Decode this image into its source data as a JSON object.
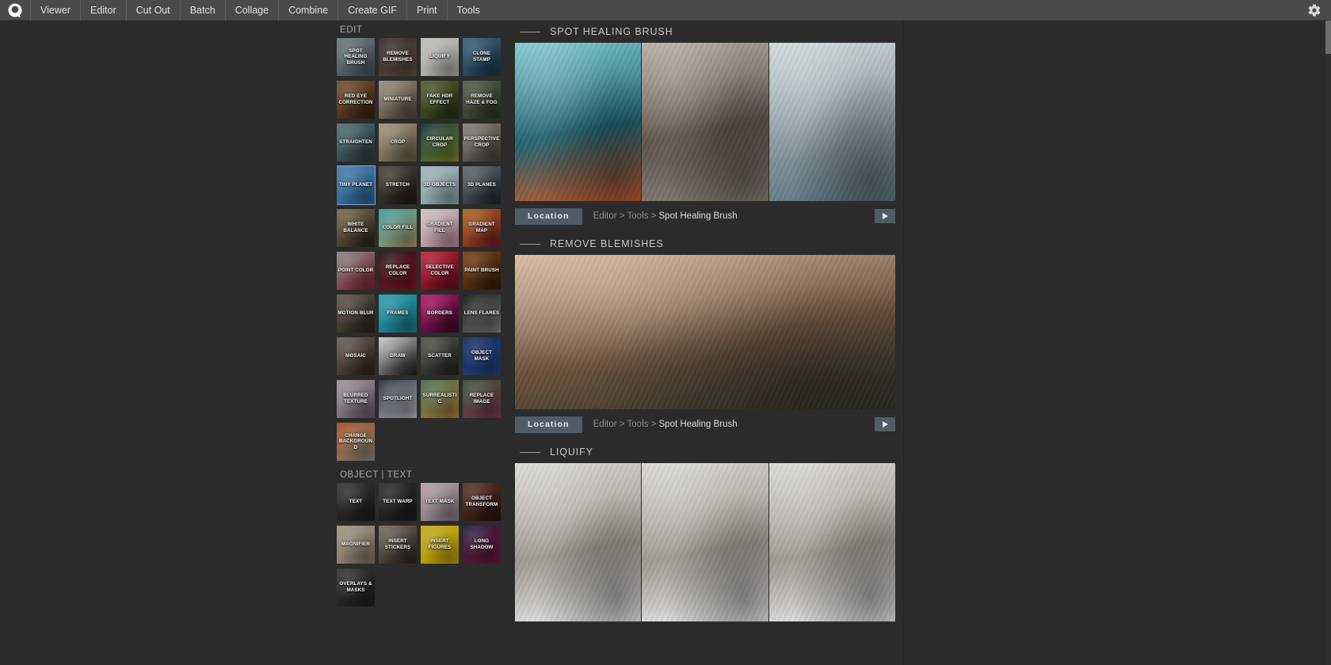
{
  "app": {
    "logo_icon": "app-logo-icon",
    "gear_icon": "gear-icon"
  },
  "menubar": {
    "items": [
      {
        "label": "Viewer"
      },
      {
        "label": "Editor"
      },
      {
        "label": "Cut Out"
      },
      {
        "label": "Batch"
      },
      {
        "label": "Collage"
      },
      {
        "label": "Combine"
      },
      {
        "label": "Create GIF"
      },
      {
        "label": "Print"
      },
      {
        "label": "Tools"
      }
    ]
  },
  "sections": [
    {
      "id": "edit",
      "title": "EDIT",
      "tiles": [
        {
          "label": "SPOT HEALING BRUSH",
          "c1": "#7d8a90",
          "c2": "#4a5a63",
          "sel": false
        },
        {
          "label": "REMOVE BLEMISHES",
          "c1": "#3a2f2c",
          "c2": "#6b5548",
          "sel": false
        },
        {
          "label": "LIQUIFY",
          "c1": "#d8d8d4",
          "c2": "#b9b9b4",
          "sel": false
        },
        {
          "label": "CLONE STAMP",
          "c1": "#3d6f92",
          "c2": "#203a4c",
          "sel": false
        },
        {
          "label": "RED EYE CORRECTION",
          "c1": "#8a5c36",
          "c2": "#3c2414",
          "sel": false
        },
        {
          "label": "MINIATURE",
          "c1": "#b2a48e",
          "c2": "#58493a",
          "sel": false
        },
        {
          "label": "FAKE HDR EFFECT",
          "c1": "#5f6b34",
          "c2": "#2b3317",
          "sel": false
        },
        {
          "label": "REMOVE HAZE & FOG",
          "c1": "#5f6a4d",
          "c2": "#30382a",
          "sel": false
        },
        {
          "label": "STRAIGHTEN",
          "c1": "#5b7e86",
          "c2": "#2b3e46",
          "sel": false
        },
        {
          "label": "CROP",
          "c1": "#b9a98c",
          "c2": "#6b5f48",
          "sel": false
        },
        {
          "label": "CIRCULAR CROP",
          "c1": "#10323f",
          "c2": "#8a9a32",
          "sel": false
        },
        {
          "label": "PERSPECTIVE CROP",
          "c1": "#9a9184",
          "c2": "#4a443c",
          "sel": false
        },
        {
          "label": "TINY PLANET",
          "c1": "#4f8fc4",
          "c2": "#2f6b9e",
          "sel": true
        },
        {
          "label": "STRETCH",
          "c1": "#5a5246",
          "c2": "#1e1a16",
          "sel": false
        },
        {
          "label": "3D OBJECTS",
          "c1": "#b9cfd2",
          "c2": "#8fb0b5",
          "sel": false
        },
        {
          "label": "3D PLANES",
          "c1": "#6e7a84",
          "c2": "#23282e",
          "sel": false
        },
        {
          "label": "WHITE BALANCE",
          "c1": "#8d7a58",
          "c2": "#2e2419",
          "sel": false
        },
        {
          "label": "COLOR FILL",
          "c1": "#3fb3b0",
          "c2": "#c2a36b",
          "sel": false
        },
        {
          "label": "GRADIENT FILL",
          "c1": "#e8e2dc",
          "c2": "#c98fa3",
          "sel": false
        },
        {
          "label": "GRADIENT MAP",
          "c1": "#c8741a",
          "c2": "#7a1a2a",
          "sel": false
        },
        {
          "label": "POINT COLOR",
          "c1": "#9b9a96",
          "c2": "#8b2030",
          "sel": false
        },
        {
          "label": "REPLACE COLOR",
          "c1": "#2a1416",
          "c2": "#8d1c28",
          "sel": false
        },
        {
          "label": "SELECTIVE COLOR",
          "c1": "#d6263f",
          "c2": "#6e0f1c",
          "sel": false
        },
        {
          "label": "PAINT BRUSH",
          "c1": "#8a4a1c",
          "c2": "#3a1c0a",
          "sel": false
        },
        {
          "label": "MOTION BLUR",
          "c1": "#6e6257",
          "c2": "#2a241e",
          "sel": false
        },
        {
          "label": "FRAMES",
          "c1": "#2db3c8",
          "c2": "#1b7e93",
          "sel": false
        },
        {
          "label": "BORDERS",
          "c1": "#d0197a",
          "c2": "#3a0a2a",
          "sel": false
        },
        {
          "label": "LENS FLARES",
          "c1": "#141414",
          "c2": "#8e8e8e",
          "sel": false
        },
        {
          "label": "MOSAIC",
          "c1": "#7a6a5e",
          "c2": "#2e2620",
          "sel": false
        },
        {
          "label": "DRAW",
          "c1": "#e6e6e6",
          "c2": "#1a1a1a",
          "sel": false
        },
        {
          "label": "SCATTER",
          "c1": "#5d5f58",
          "c2": "#24251f",
          "sel": false
        },
        {
          "label": "OBJECT MASK",
          "c1": "#13306b",
          "c2": "#2a4a8c",
          "sel": false
        },
        {
          "label": "BLURRED TEXTURE",
          "c1": "#b9a7b5",
          "c2": "#6e5f70",
          "sel": false
        },
        {
          "label": "SPOTLIGHT",
          "c1": "#2a3240",
          "c2": "#c9ccd4",
          "sel": false
        },
        {
          "label": "SURREALISTIC",
          "c1": "#4a7a5a",
          "c2": "#c08a3a",
          "sel": false
        },
        {
          "label": "REPLACE IMAGE",
          "c1": "#3a5a3a",
          "c2": "#8a3a5a",
          "sel": false
        },
        {
          "label": "CHANGE BACKGROUND",
          "c1": "#c4531c",
          "c2": "#8d9a8d",
          "sel": false
        }
      ]
    },
    {
      "id": "object-text",
      "title": "OBJECT | TEXT",
      "tiles": [
        {
          "label": "TEXT",
          "c1": "#3a3a3a",
          "c2": "#1e1e1e",
          "sel": false
        },
        {
          "label": "TEXT WARP",
          "c1": "#333333",
          "c2": "#1c1c1c",
          "sel": false
        },
        {
          "label": "TEXT MASK",
          "c1": "#cbb8bd",
          "c2": "#8f7f8a",
          "sel": false
        },
        {
          "label": "OBJECT TRANSFORM",
          "c1": "#6a3a2a",
          "c2": "#2a1410",
          "sel": false
        },
        {
          "label": "MAGNIFIER",
          "c1": "#b8aa96",
          "c2": "#8a7a66",
          "sel": false
        },
        {
          "label": "INSERT STICKERS",
          "c1": "#8a7a6a",
          "c2": "#2a2420",
          "sel": false
        },
        {
          "label": "INSERT FIGURES",
          "c1": "#e0c41a",
          "c2": "#c7a800",
          "sel": false
        },
        {
          "label": "LONG SHADOW",
          "c1": "#2a1f4a",
          "c2": "#7a1a3a",
          "sel": false
        },
        {
          "label": "OVERLAYS & MASKS",
          "c1": "#3a3a3a",
          "c2": "#202020",
          "sel": false
        }
      ]
    }
  ],
  "content_blocks": [
    {
      "title": "SPOT HEALING BRUSH",
      "layout": "triple",
      "panes": [
        {
          "name": "pool-palm-photo",
          "c1": "#79c6cd",
          "c2": "#1c5f6e",
          "c3": "#c45a2a"
        },
        {
          "name": "brick-wall-numbers-photo",
          "c1": "#b2a99c",
          "c2": "#5a5148",
          "c3": "#8a8276"
        },
        {
          "name": "beach-people-photo",
          "c1": "#cfd6d8",
          "c2": "#8a9aa0",
          "c3": "#5b7480"
        }
      ],
      "location": {
        "button_label": "Location",
        "crumbs": [
          "Editor",
          "Tools"
        ],
        "current": "Spot Healing Brush",
        "separator": ">",
        "play_icon": "play-icon"
      }
    },
    {
      "title": "REMOVE BLEMISHES",
      "layout": "single",
      "panes": [
        {
          "name": "portrait-woman-photo",
          "c1": "#d8b79a",
          "c2": "#6a503c",
          "c3": "#2e3326"
        }
      ],
      "location": {
        "button_label": "Location",
        "crumbs": [
          "Editor",
          "Tools"
        ],
        "current": "Spot Healing Brush",
        "separator": ">",
        "play_icon": "play-icon"
      }
    },
    {
      "title": "LIQUIFY",
      "layout": "triple",
      "panes": [
        {
          "name": "arctic-fox-photo-1",
          "c1": "#d9d6d2",
          "c2": "#9b968f",
          "c3": "#efeeec"
        },
        {
          "name": "arctic-fox-photo-2",
          "c1": "#d9d6d2",
          "c2": "#9b968f",
          "c3": "#efeeec"
        },
        {
          "name": "arctic-fox-photo-3",
          "c1": "#d9d6d2",
          "c2": "#9b968f",
          "c3": "#efeeec"
        }
      ],
      "location": null
    }
  ],
  "colors": {
    "accent": "#4f5b68",
    "menubar_bg": "#4a4a4a",
    "panel_bg": "#2b2b2b",
    "selection": "#7ea9d8"
  },
  "scrollbar": {
    "name": "vertical-scrollbar",
    "thumb_name": "scrollbar-thumb"
  }
}
